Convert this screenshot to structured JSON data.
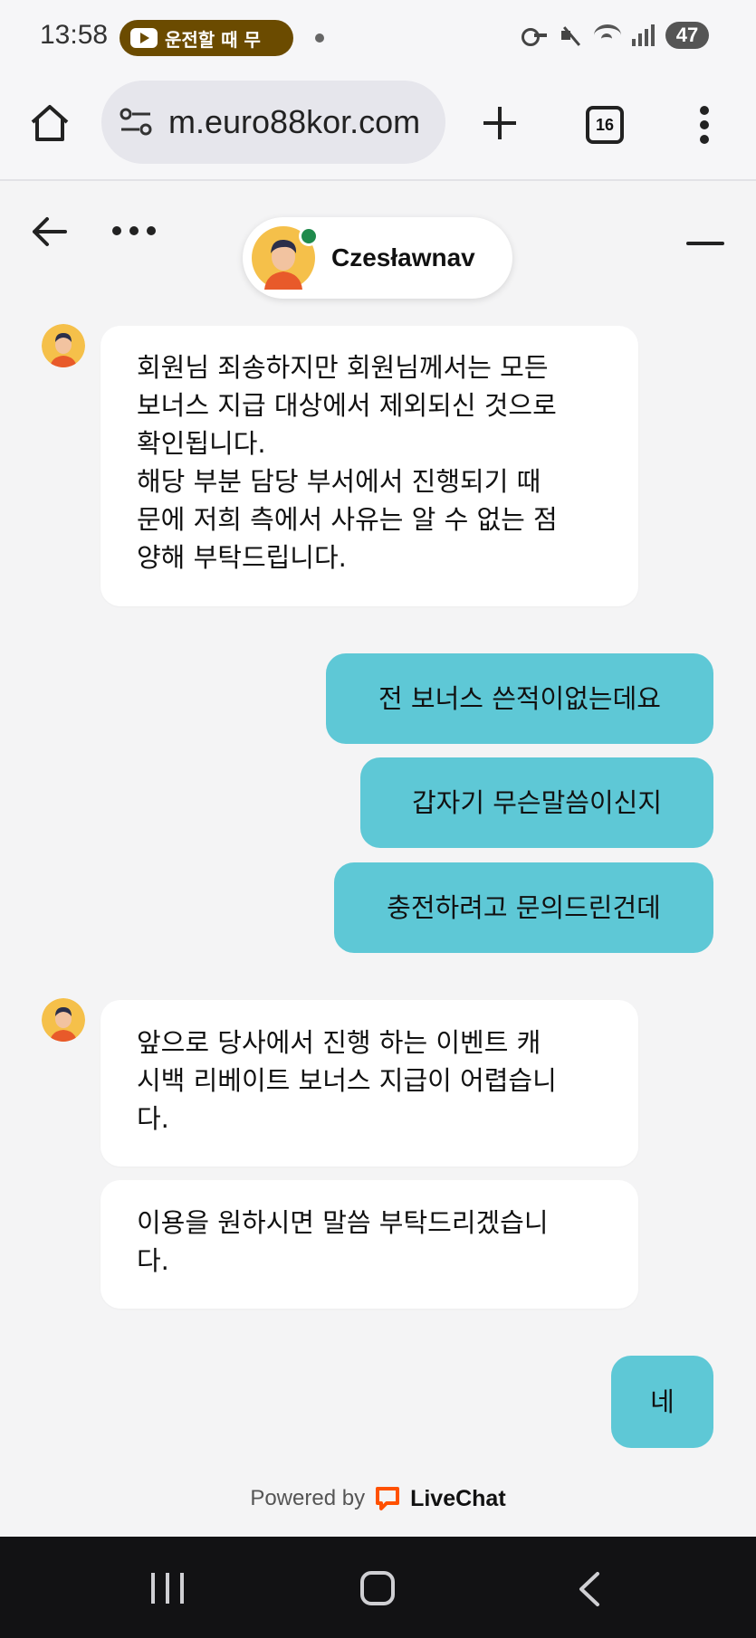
{
  "status_bar": {
    "time": "13:58",
    "youtube_notice": "운전할 때 무",
    "battery": "47"
  },
  "browser": {
    "url": "m.euro88kor.com",
    "tab_count": "16"
  },
  "chat": {
    "agent_name": "Czesławnav",
    "messages": [
      {
        "from": "agent",
        "text": "회원님 죄송하지만 회원님께서는 모든 보너스 지급 대상에서 제외되신 것으로 확인됩니다.\n해당 부분 담당 부서에서 진행되기 때문에 저희 측에서 사유는 알 수 없는 점 양해 부탁드립니다."
      },
      {
        "from": "user",
        "text": "전 보너스 쓴적이없는데요"
      },
      {
        "from": "user",
        "text": "갑자기 무슨말씀이신지"
      },
      {
        "from": "user",
        "text": "충전하려고 문의드린건데"
      },
      {
        "from": "agent",
        "text": "앞으로 당사에서 진행 하는 이벤트 캐시백 리베이트 보너스 지급이 어렵습니다."
      },
      {
        "from": "agent",
        "text": "이용을 원하시면 말씀 부탁드리겠습니다."
      },
      {
        "from": "user",
        "text": "네"
      }
    ],
    "agent_lines": {
      "m0": [
        "회원님 죄송하지만 회원님께서는 모든",
        "보너스 지급 대상에서 제외되신 것으로",
        "확인됩니다.",
        "해당 부분 담당 부서에서 진행되기 때",
        "문에 저희 측에서 사유는 알 수 없는 점",
        "양해 부탁드립니다."
      ],
      "m4": [
        "앞으로 당사에서 진행 하는 이벤트 캐",
        "시백 리베이트 보너스 지급이 어렵습니",
        "다."
      ],
      "m5": [
        "이용을 원하시면 말씀 부탁드리겠습니",
        "다."
      ]
    },
    "powered_by_label": "Powered by",
    "powered_by_brand": "LiveChat"
  },
  "colors": {
    "user_bubble": "#5ec8d6",
    "agent_bubble": "#ffffff",
    "background": "#f4f4f5",
    "online": "#1f8a4c",
    "livechat_brand": "#ff5100"
  }
}
